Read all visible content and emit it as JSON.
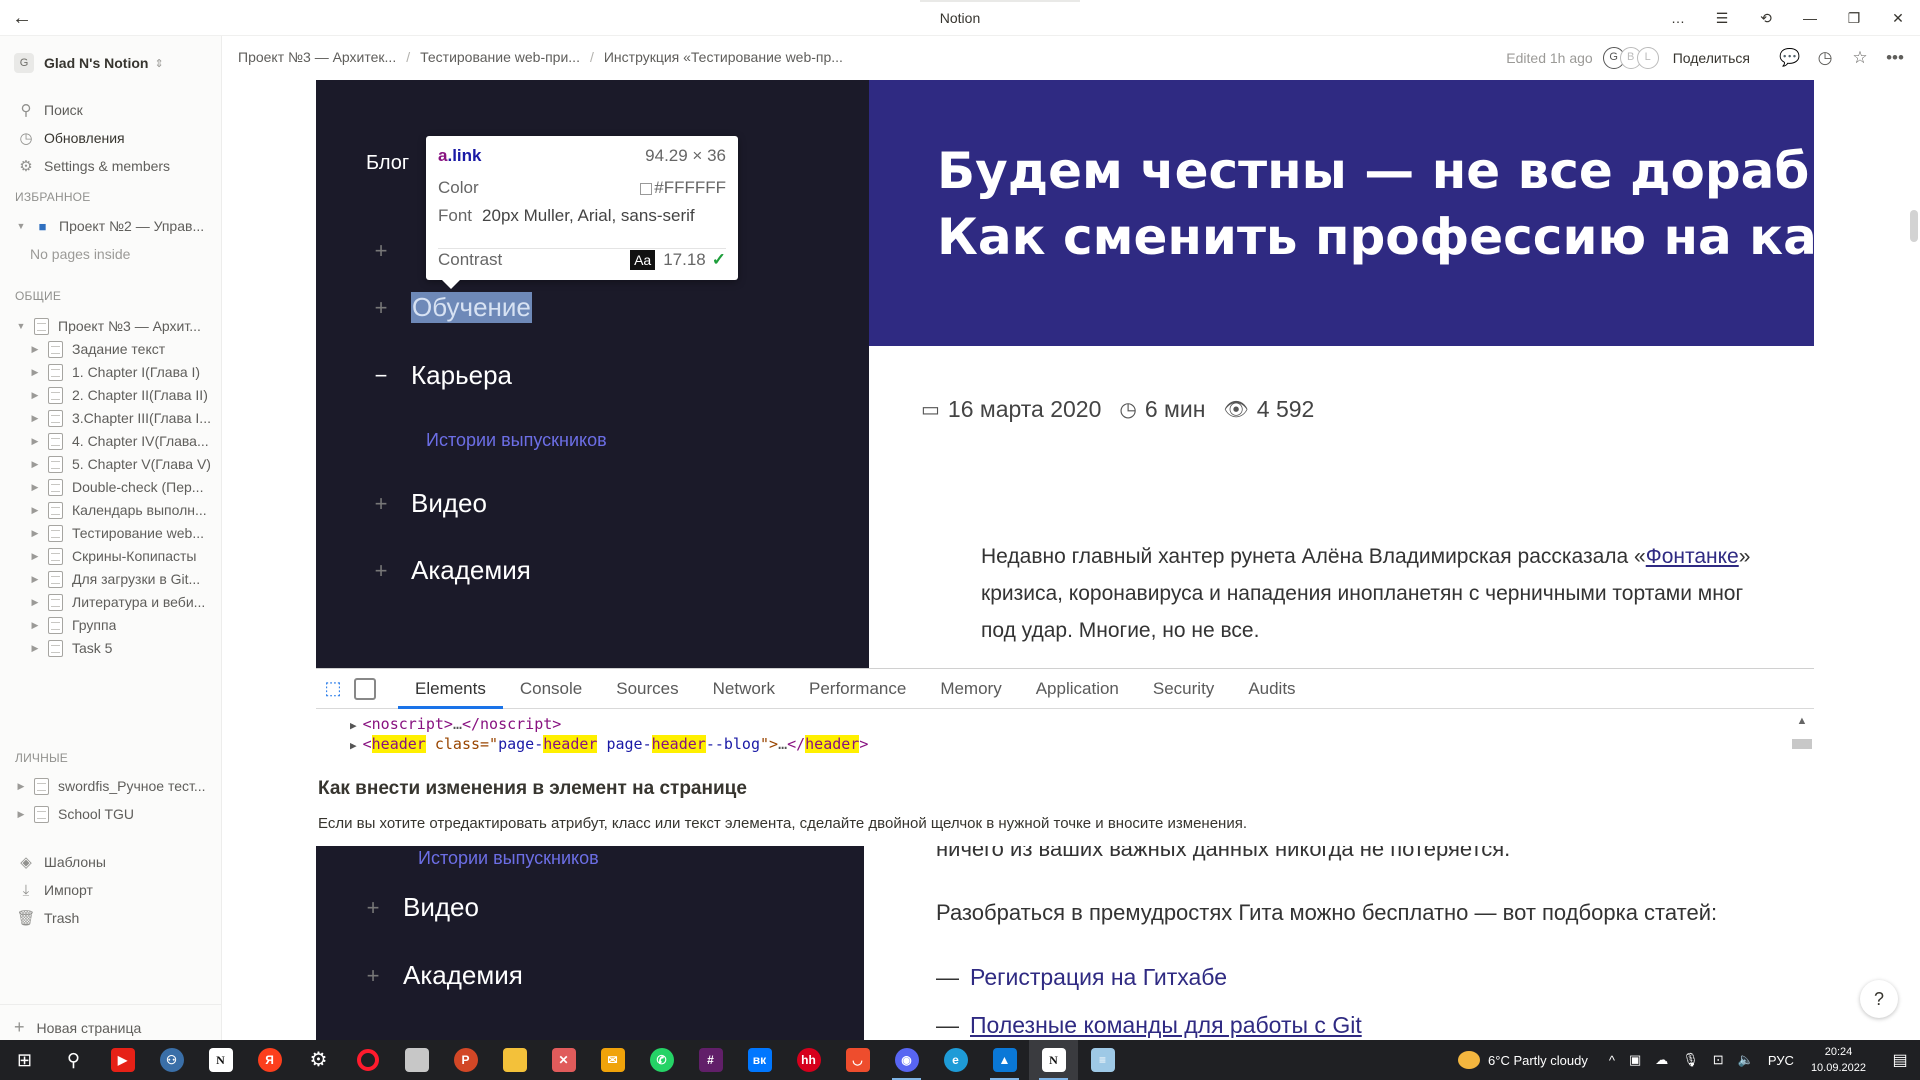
{
  "window": {
    "title": "Notion",
    "back_glyph": "←",
    "controls": [
      "…",
      "☰",
      "⟲",
      "—",
      "❐",
      "✕"
    ]
  },
  "sidebar": {
    "workspace": {
      "badge": "G",
      "name": "Glad N's Notion",
      "chevron": "⇕"
    },
    "nav": [
      {
        "icon": "⚲",
        "label": "Поиск"
      },
      {
        "icon": "◷",
        "label": "Обновления"
      },
      {
        "icon": "⚙",
        "label": "Settings & members"
      }
    ],
    "favorites_header": "ИЗБРАННОЕ",
    "favorites": [
      {
        "label": "Проект №2 — Управ...",
        "emoji": "👕"
      }
    ],
    "favorites_empty": "No pages inside",
    "shared_header": "ОБЩИЕ",
    "shared": [
      {
        "label": "Проект №3 — Архит...",
        "expanded": true,
        "indent": 0
      },
      {
        "label": "Задание текст",
        "indent": 1
      },
      {
        "label": "1. Chapter I(Глава I)",
        "indent": 1
      },
      {
        "label": "2. Chapter II(Глава II)",
        "indent": 1
      },
      {
        "label": "3.Chapter III(Глава I...",
        "indent": 1
      },
      {
        "label": "4. Chapter IV(Глава...",
        "indent": 1
      },
      {
        "label": "5. Chapter V(Глава V)",
        "indent": 1
      },
      {
        "label": "Double-check (Пер...",
        "indent": 1
      },
      {
        "label": "Календарь выполн...",
        "indent": 1
      },
      {
        "label": "Тестирование web...",
        "indent": 1
      },
      {
        "label": "Скрины-Копипасты",
        "indent": 1
      },
      {
        "label": "Для загрузки в Git...",
        "indent": 1
      },
      {
        "label": "Литература и веби...",
        "indent": 1
      },
      {
        "label": "Группа",
        "indent": 1
      },
      {
        "label": "Task 5",
        "indent": 1
      }
    ],
    "private_header": "ЛИЧНЫЕ",
    "private": [
      {
        "label": "swordfis_Ручное тест..."
      },
      {
        "label": "School TGU"
      }
    ],
    "tools": [
      {
        "icon": "◈",
        "label": "Шаблоны"
      },
      {
        "icon": "⤓",
        "label": "Импорт"
      },
      {
        "icon": "🗑",
        "label": "Trash"
      }
    ],
    "new_page": {
      "icon": "+",
      "label": "Новая страница"
    }
  },
  "topbar": {
    "breadcrumbs": [
      "Проект №3 — Архитек...",
      "Тестирование web-при...",
      "Инструкция «Тестирование web-пр..."
    ],
    "separator": "/",
    "edited": "Edited 1h ago",
    "avatars": [
      "G",
      "B",
      "L"
    ],
    "share_label": "Поделиться",
    "icons": [
      "💬",
      "◷",
      "☆",
      "•••"
    ]
  },
  "shot1": {
    "menu": {
      "blog": "Блог",
      "items": [
        {
          "sign": "+",
          "label": "Обучение",
          "highlighted": true
        },
        {
          "sign": "−",
          "label": "Карьера"
        },
        {
          "sign": "+",
          "label": "Видео"
        },
        {
          "sign": "+",
          "label": "Академия"
        }
      ],
      "sub": "Истории выпускников",
      "plus_above": "+"
    },
    "tooltip": {
      "selector_tag": "a",
      "selector_class": ".link",
      "size": "94.29 × 36",
      "color_label": "Color",
      "color_value": "#FFFFFF",
      "font_label": "Font",
      "font_value": "20px Muller, Arial, sans-serif",
      "contrast_label": "Contrast",
      "contrast_aa": "Aa",
      "contrast_value": "17.18",
      "contrast_check": "✓"
    },
    "hero_lines": [
      "Будем честны — не все дораб",
      "Как сменить профессию на ка"
    ],
    "meta": {
      "date_icon": "▭",
      "date": "16 марта 2020",
      "time_icon": "◷",
      "time": "6 мин",
      "views_icon": "👁",
      "views": "4 592"
    },
    "para": {
      "line1_pre": "Недавно главный хантер рунета Алёна Владимирская рассказала «",
      "line1_link": "Фонтанке",
      "line1_post": "»",
      "line2": "кризиса, коронавируса и нападения инопланетян с черничными тортами мног",
      "line3": "под удар. Многие, но не все."
    },
    "devtools": {
      "tabs": [
        "Elements",
        "Console",
        "Sources",
        "Network",
        "Performance",
        "Memory",
        "Application",
        "Security",
        "Audits"
      ],
      "selected_tab": "Elements",
      "code1": {
        "open": "<noscript>",
        "dots": "…",
        "close": "</noscript>"
      },
      "code2": {
        "lt": "<",
        "tag": "header",
        "attr": " class",
        "eq": "=\"",
        "v1": "page-",
        "v2": "header",
        "v3": " page-",
        "v4": "header",
        "v5": "--blog",
        "q": "\">",
        "dots": "…",
        "close_lt": "</",
        "close_tag": "header",
        "gt": ">"
      },
      "scroll_up": "▲"
    }
  },
  "section": {
    "heading": "Как внести изменения в элемент на странице",
    "text": "Если вы хотите отредактировать атрибут, класс или текст элемента, сделайте двойной щелчок в нужной точке и вносите изменения."
  },
  "shot2": {
    "sub": "Истории выпускников",
    "items": [
      {
        "sign": "+",
        "label": "Видео"
      },
      {
        "sign": "+",
        "label": "Академия"
      }
    ],
    "cut_text": "ничего из ваших важных данных никогда не потеряется.",
    "intro": "Разобраться в премудростях Гита можно бесплатно — вот подборка статей:",
    "list": [
      {
        "dash": "—",
        "label": "Регистрация на Гитхабе",
        "underline": false
      },
      {
        "dash": "—",
        "label": "Полезные команды для работы с Git",
        "underline": true
      }
    ]
  },
  "help": "?",
  "taskbar": {
    "apps": [
      "start-icon",
      "search-icon",
      "youtube-icon",
      "python-icon",
      "notion-icon",
      "yandex-icon",
      "settings-icon",
      "opera-icon",
      "explorer-icon",
      "powerpoint-icon",
      "folder-icon",
      "app-icon",
      "mail-icon",
      "whatsapp-icon",
      "slack-icon",
      "vk-icon",
      "hh-icon",
      "app2-icon",
      "discord-icon",
      "edge-icon",
      "photos-icon",
      "notion-running-icon",
      "notepad-icon"
    ],
    "weather": "6°C  Partly cloudy",
    "lang": "РУС",
    "time": "20:24",
    "date": "10.09.2022"
  },
  "colors": {
    "sidebar_bg": "#fbfbfa",
    "dark_menu": "#1b1a29",
    "hero": "#2f2a82",
    "menu_sub": "#6c6ee5",
    "taskbar": "#1f2023",
    "devtools_accent": "#1a73e8"
  }
}
